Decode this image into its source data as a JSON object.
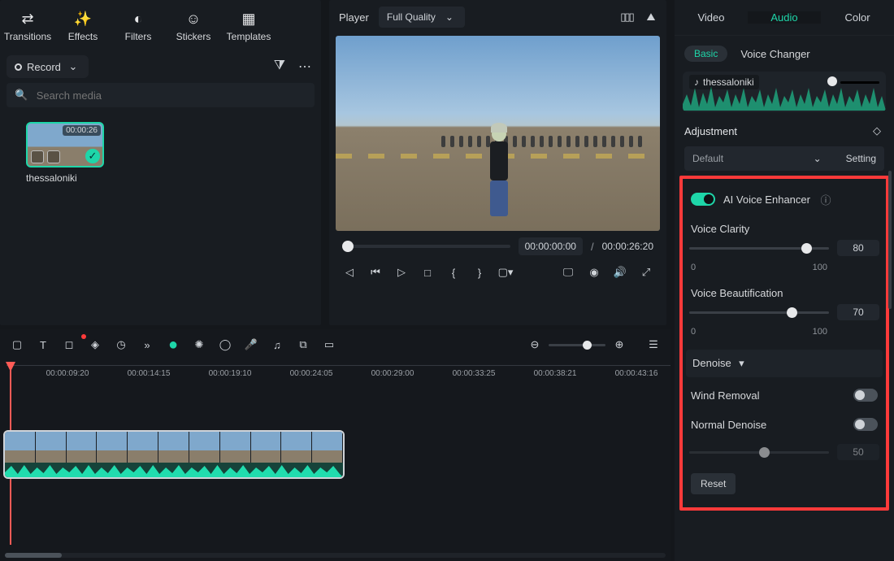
{
  "toolbar": {
    "items": [
      {
        "label": "Transitions",
        "icon": "⇄"
      },
      {
        "label": "Effects",
        "icon": "✨"
      },
      {
        "label": "Filters",
        "icon": "◯"
      },
      {
        "label": "Stickers",
        "icon": "☺"
      },
      {
        "label": "Templates",
        "icon": "▤"
      }
    ],
    "record": "Record"
  },
  "search": {
    "placeholder": "Search media"
  },
  "media": {
    "name": "thessaloniki",
    "duration": "00:00:26"
  },
  "player": {
    "title": "Player",
    "quality": "Full Quality",
    "current": "00:00:00:00",
    "sep": "/",
    "total": "00:00:26:20"
  },
  "timeline": {
    "ticks": [
      "00:00:09:20",
      "00:00:14:15",
      "00:00:19:10",
      "00:00:24:05",
      "00:00:29:00",
      "00:00:33:25",
      "00:00:38:21",
      "00:00:43:16"
    ]
  },
  "side": {
    "tabs": {
      "video": "Video",
      "audio": "Audio",
      "color": "Color"
    },
    "sub": {
      "basic": "Basic",
      "voice": "Voice Changer"
    },
    "clip": "thessaloniki",
    "adjustment": "Adjustment",
    "preset": "Default",
    "setting": "Setting",
    "ai": "AI Voice Enhancer",
    "clarity": {
      "label": "Voice Clarity",
      "value": "80",
      "min": "0",
      "max": "100"
    },
    "beauty": {
      "label": "Voice Beautification",
      "value": "70",
      "min": "0",
      "max": "100"
    },
    "denoiseHeader": "Denoise",
    "wind": "Wind Removal",
    "normal": "Normal Denoise",
    "normalVal": "50",
    "reset": "Reset"
  }
}
